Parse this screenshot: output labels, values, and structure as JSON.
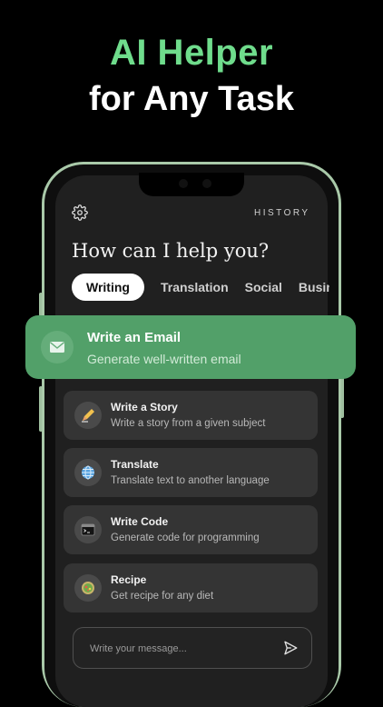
{
  "headline": {
    "line1": "AI Helper",
    "line2": "for Any Task"
  },
  "header": {
    "history_label": "HISTORY",
    "question": "How can I help you?"
  },
  "tabs": [
    {
      "label": "Writing",
      "active": true
    },
    {
      "label": "Translation",
      "active": false
    },
    {
      "label": "Social",
      "active": false
    },
    {
      "label": "Business",
      "active": false
    }
  ],
  "featured": {
    "title": "Write an Email",
    "subtitle": "Generate well-written email",
    "icon": "envelope-icon"
  },
  "cards": [
    {
      "title": "Write a Story",
      "subtitle": "Write a story from a given subject",
      "icon": "pencil-icon"
    },
    {
      "title": "Translate",
      "subtitle": "Translate text to another language",
      "icon": "globe-icon"
    },
    {
      "title": "Write Code",
      "subtitle": "Generate code for programming",
      "icon": "terminal-icon"
    },
    {
      "title": "Recipe",
      "subtitle": "Get recipe for any diet",
      "icon": "salad-icon"
    }
  ],
  "composer": {
    "placeholder": "Write your message..."
  },
  "colors": {
    "accent": "#6fdc8c",
    "featured": "#52a069",
    "card": "#343434",
    "screen": "#202020"
  }
}
